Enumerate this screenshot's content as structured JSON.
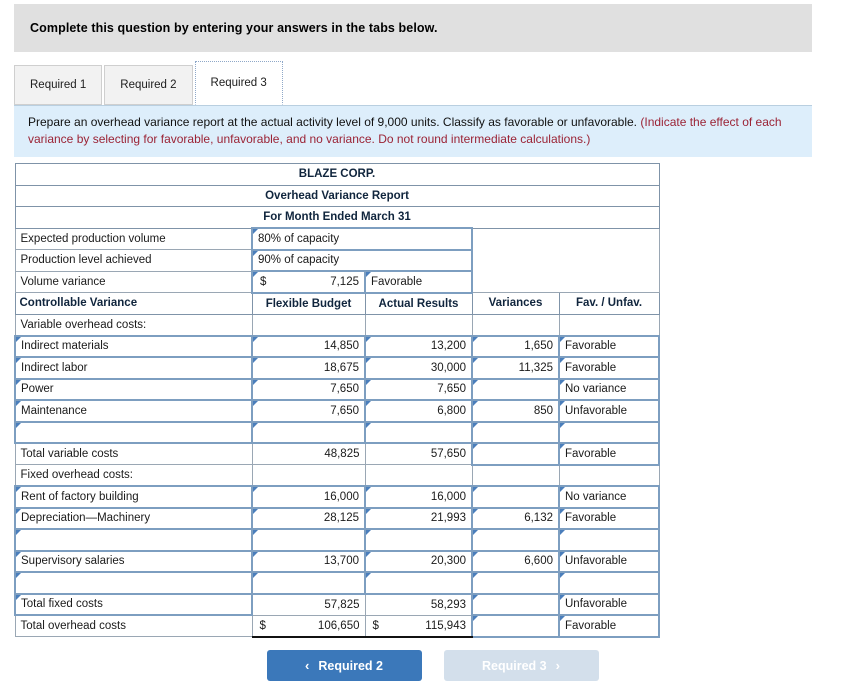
{
  "banner": {
    "text": "Complete this question by entering your answers in the tabs below."
  },
  "tabs": [
    {
      "label": "Required 1",
      "active": false
    },
    {
      "label": "Required 2",
      "active": false
    },
    {
      "label": "Required 3",
      "active": true
    }
  ],
  "instruction": {
    "main": "Prepare an overhead variance report at the actual activity level of 9,000 units. Classify as favorable or unfavorable.",
    "hint": "(Indicate the effect of each variance by selecting for favorable, unfavorable, and no variance. Do not round intermediate calculations.)"
  },
  "report": {
    "title1": "BLAZE CORP.",
    "title2": "Overhead Variance Report",
    "title3": "For Month Ended March 31",
    "preamble": [
      {
        "label": "Expected production volume",
        "value": "80% of capacity"
      },
      {
        "label": "Production level achieved",
        "value": "90% of capacity"
      }
    ],
    "volume_variance": {
      "label": "Volume variance",
      "dollar": "$",
      "amount": "7,125",
      "favunfav": "Favorable"
    },
    "columns": {
      "c0": "Controllable Variance",
      "c1": "Flexible Budget",
      "c2": "Actual Results",
      "c3": "Variances",
      "c4": "Fav. / Unfav."
    },
    "variable_section_label": "Variable overhead costs:",
    "variable_rows": [
      {
        "label": "Indirect materials",
        "flexible": "14,850",
        "actual": "13,200",
        "variance": "1,650",
        "favunfav": "Favorable"
      },
      {
        "label": "Indirect labor",
        "flexible": "18,675",
        "actual": "30,000",
        "variance": "11,325",
        "favunfav": "Favorable"
      },
      {
        "label": "Power",
        "flexible": "7,650",
        "actual": "7,650",
        "variance": "",
        "favunfav": "No variance"
      },
      {
        "label": "Maintenance",
        "flexible": "7,650",
        "actual": "6,800",
        "variance": "850",
        "favunfav": "Unfavorable"
      },
      {
        "label": "",
        "flexible": "",
        "actual": "",
        "variance": "",
        "favunfav": ""
      }
    ],
    "total_variable": {
      "label": "Total variable costs",
      "flexible": "48,825",
      "actual": "57,650",
      "variance": "",
      "favunfav": "Favorable"
    },
    "fixed_section_label": "Fixed overhead costs:",
    "fixed_rows": [
      {
        "label": "Rent of factory building",
        "flexible": "16,000",
        "actual": "16,000",
        "variance": "",
        "favunfav": "No variance"
      },
      {
        "label": "Depreciation—Machinery",
        "flexible": "28,125",
        "actual": "21,993",
        "variance": "6,132",
        "favunfav": "Favorable"
      },
      {
        "label": "",
        "flexible": "",
        "actual": "",
        "variance": "",
        "favunfav": ""
      },
      {
        "label": "Supervisory salaries",
        "flexible": "13,700",
        "actual": "20,300",
        "variance": "6,600",
        "favunfav": "Unfavorable"
      },
      {
        "label": "",
        "flexible": "",
        "actual": "",
        "variance": "",
        "favunfav": ""
      }
    ],
    "total_fixed": {
      "label": "Total fixed costs",
      "flexible": "57,825",
      "actual": "58,293",
      "variance": "",
      "favunfav": "Unfavorable"
    },
    "total_overhead": {
      "label": "Total overhead costs",
      "dollar1": "$",
      "flexible": "106,650",
      "dollar2": "$",
      "actual": "115,943",
      "variance": "",
      "favunfav": "Favorable"
    }
  },
  "footer": {
    "prev": {
      "label": "Required 2",
      "chevron": "‹"
    },
    "next": {
      "label": "Required 3",
      "chevron": "›"
    }
  },
  "colors": {
    "header_blue": "#79a8de",
    "instruction_blue": "#ddeefb",
    "hint_red": "#9b2335",
    "button_blue": "#3b78ba",
    "button_disabled": "#d3dfeb"
  }
}
